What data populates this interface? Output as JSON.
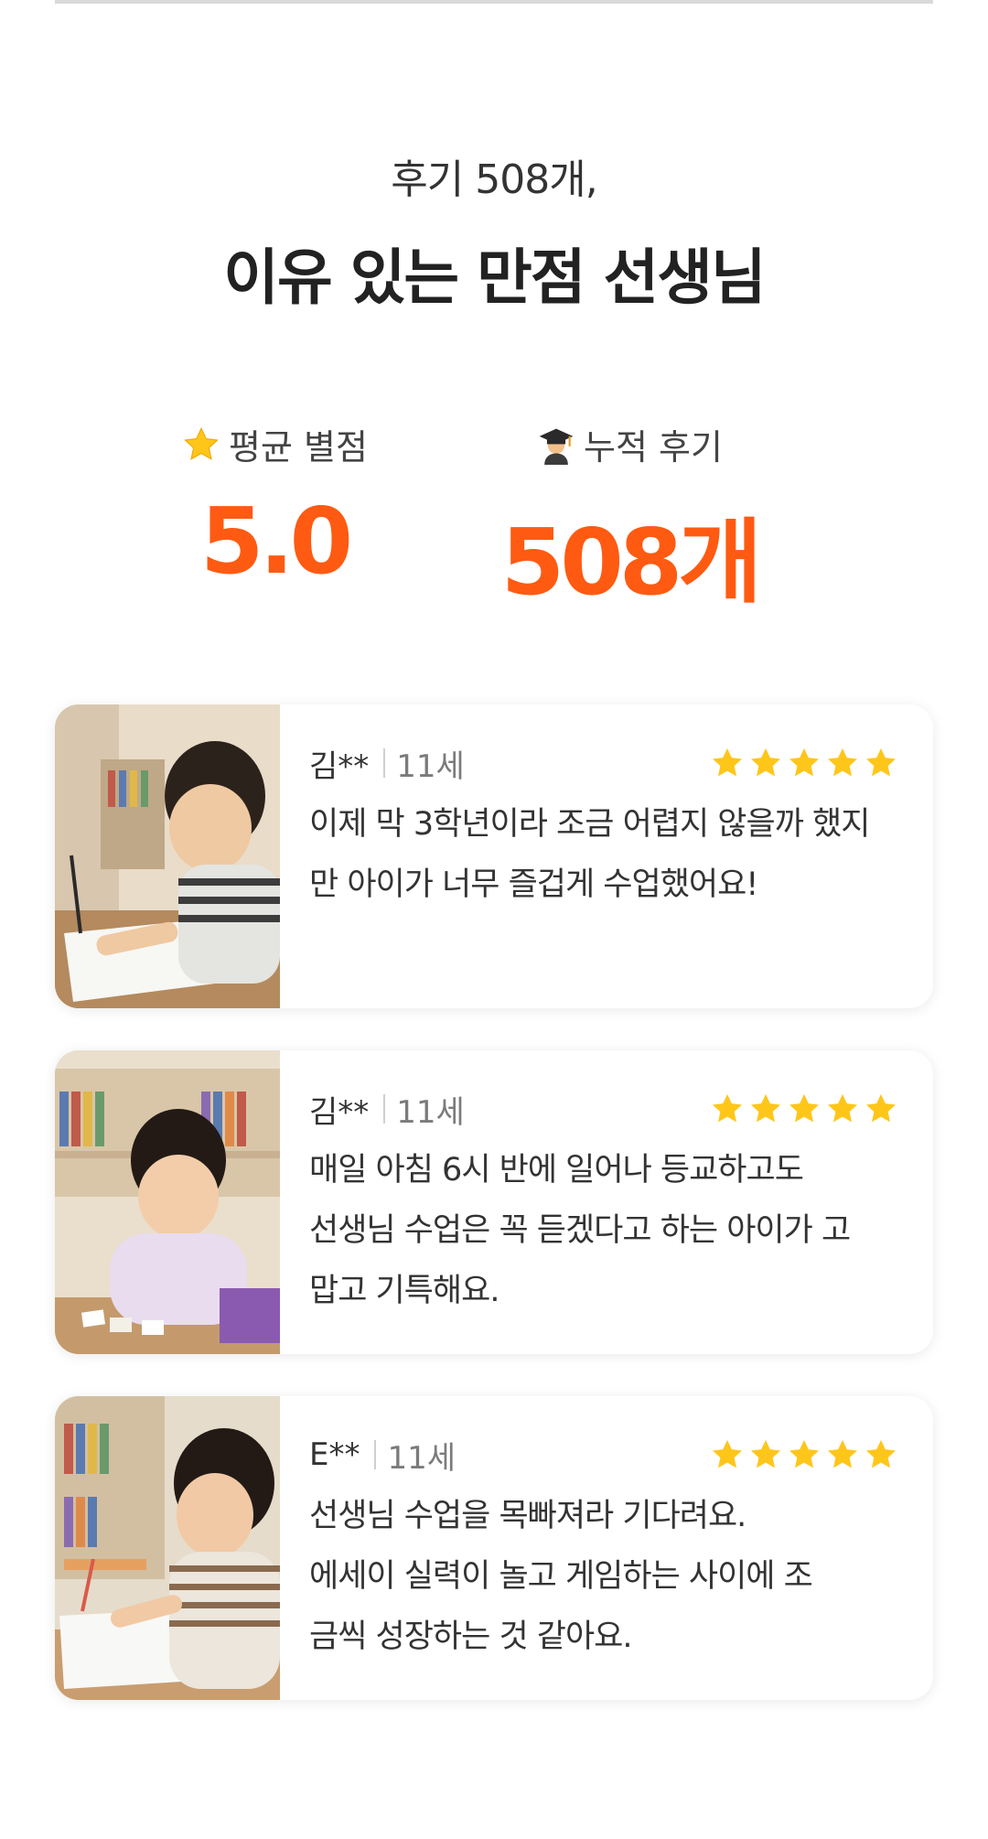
{
  "header": {
    "subtitle": "후기 508개,",
    "title": "이유 있는 만점 선생님"
  },
  "stats": {
    "average": {
      "icon": "star-icon",
      "label": "평균 별점",
      "value": "5.0"
    },
    "total": {
      "icon": "graduate-icon",
      "label": "누적 후기",
      "value": "508개"
    }
  },
  "colors": {
    "accent": "#ff5a12",
    "star": "#ffc61a"
  },
  "reviews": [
    {
      "name": "김**",
      "age": "11세",
      "rating": 5,
      "photo": "boy-writing-at-desk",
      "lines": [
        "이제 막 3학년이라 조금 어렵지 않을까 했지",
        "만 아이가 너무 즐겁게 수업했어요!"
      ]
    },
    {
      "name": "김**",
      "age": "11세",
      "rating": 5,
      "photo": "girl-playing-card-game",
      "lines": [
        "매일 아침 6시 반에 일어나 등교하고도",
        "선생님 수업은 꼭 듣겠다고 하는 아이가 고",
        "맙고 기특해요."
      ]
    },
    {
      "name": "E**",
      "age": "11세",
      "rating": 5,
      "photo": "girl-writing-in-notebook",
      "lines": [
        "선생님 수업을 목빠져라 기다려요.",
        "에세이 실력이 놀고 게임하는 사이에 조",
        "금씩 성장하는 것 같아요."
      ]
    }
  ]
}
